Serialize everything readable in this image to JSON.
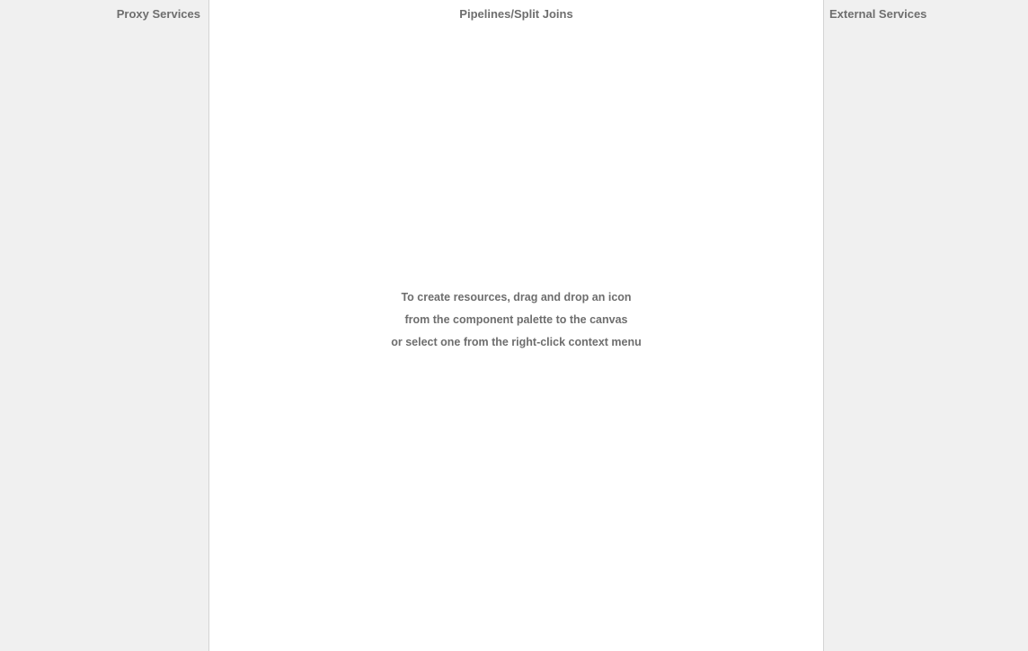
{
  "lanes": {
    "proxy": {
      "title": "Proxy Services"
    },
    "pipelines": {
      "title": "Pipelines/Split Joins"
    },
    "external": {
      "title": "External Services"
    }
  },
  "empty_hint": {
    "line1": "To create resources, drag and drop an icon",
    "line2": "from the component palette to the canvas",
    "line3": "or select one from the right-click context menu"
  },
  "colors": {
    "side_lane_background": "#f0f0f0",
    "center_lane_background": "#ffffff",
    "divider": "#d4d4d4",
    "text": "#6e6e6e"
  }
}
